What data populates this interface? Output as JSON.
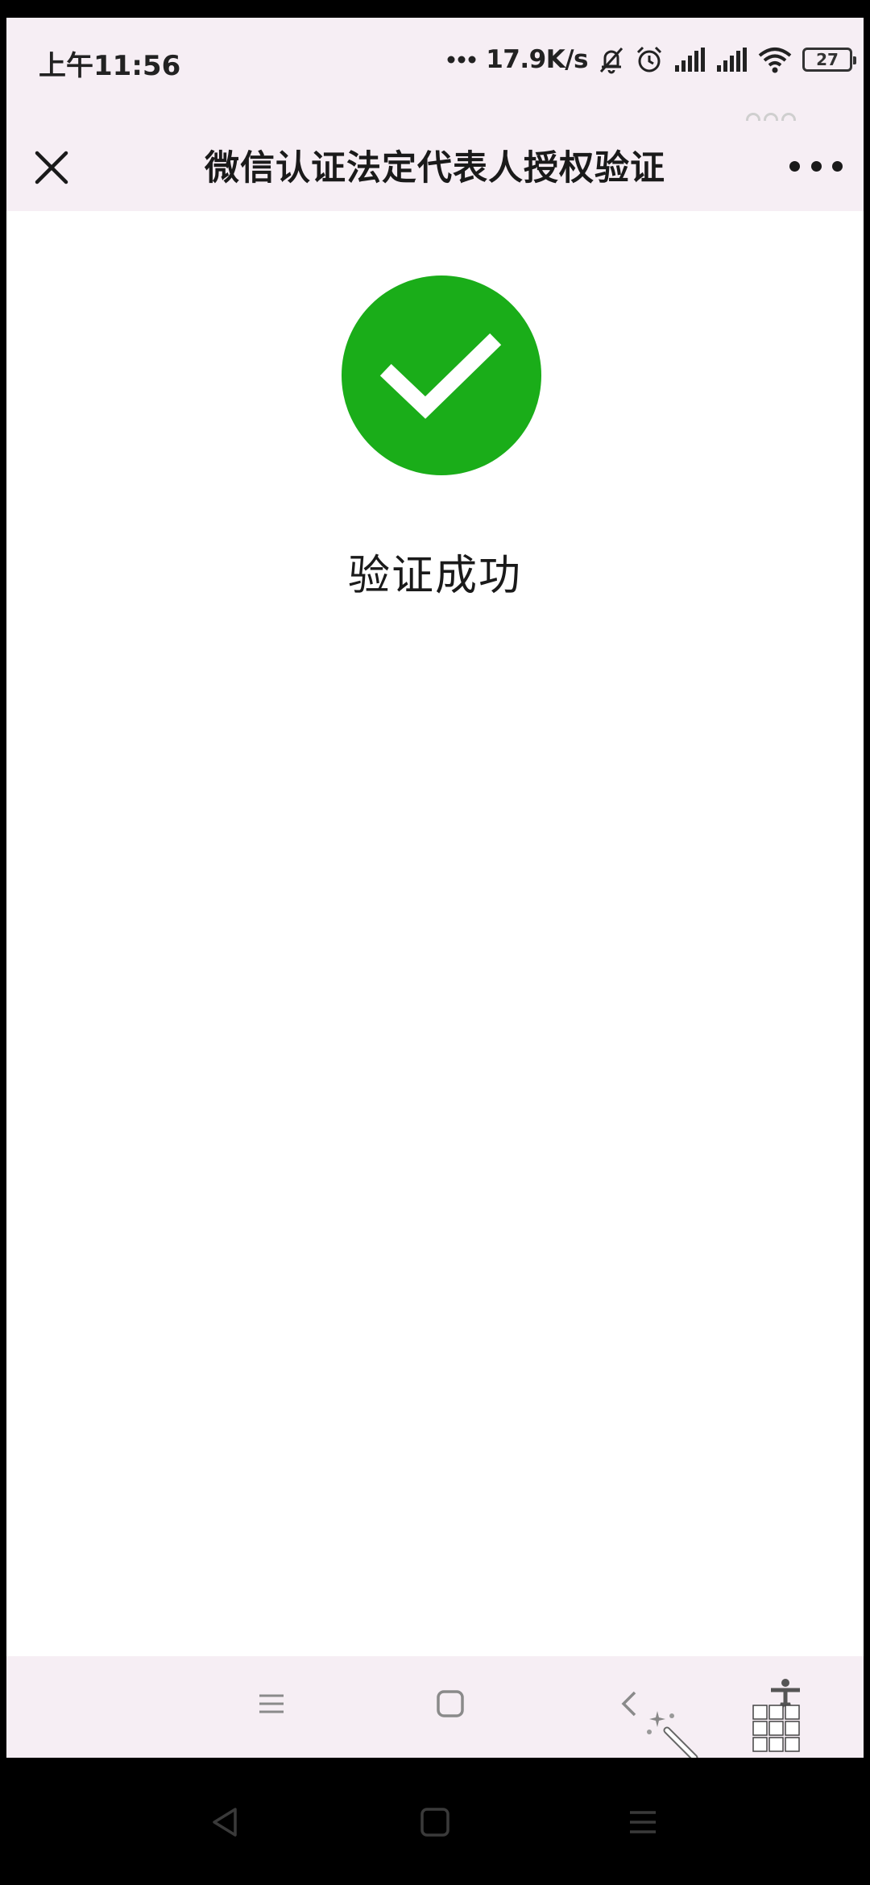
{
  "status_bar": {
    "time": "上午11:56",
    "net_speed": "17.9K/s",
    "battery": "27",
    "icons": [
      "more-dots-icon",
      "mute-bell-icon",
      "alarm-icon",
      "signal-icon",
      "signal-icon",
      "wifi-icon",
      "battery-icon"
    ]
  },
  "header": {
    "title": "微信认证法定代表人授权验证",
    "close_icon": "close-icon",
    "more_icon": "more-icon"
  },
  "main": {
    "status_icon": "check-circle-icon",
    "status_color": "#1aad19",
    "message": "验证成功"
  },
  "app_toolbar": {
    "items": [
      "menu-icon",
      "home-icon",
      "back-icon",
      "accessibility-icon",
      "magic-wand-icon",
      "keyboard-grid-icon"
    ]
  },
  "system_nav": {
    "items": [
      "back-triangle-icon",
      "home-square-icon",
      "recents-menu-icon"
    ]
  }
}
